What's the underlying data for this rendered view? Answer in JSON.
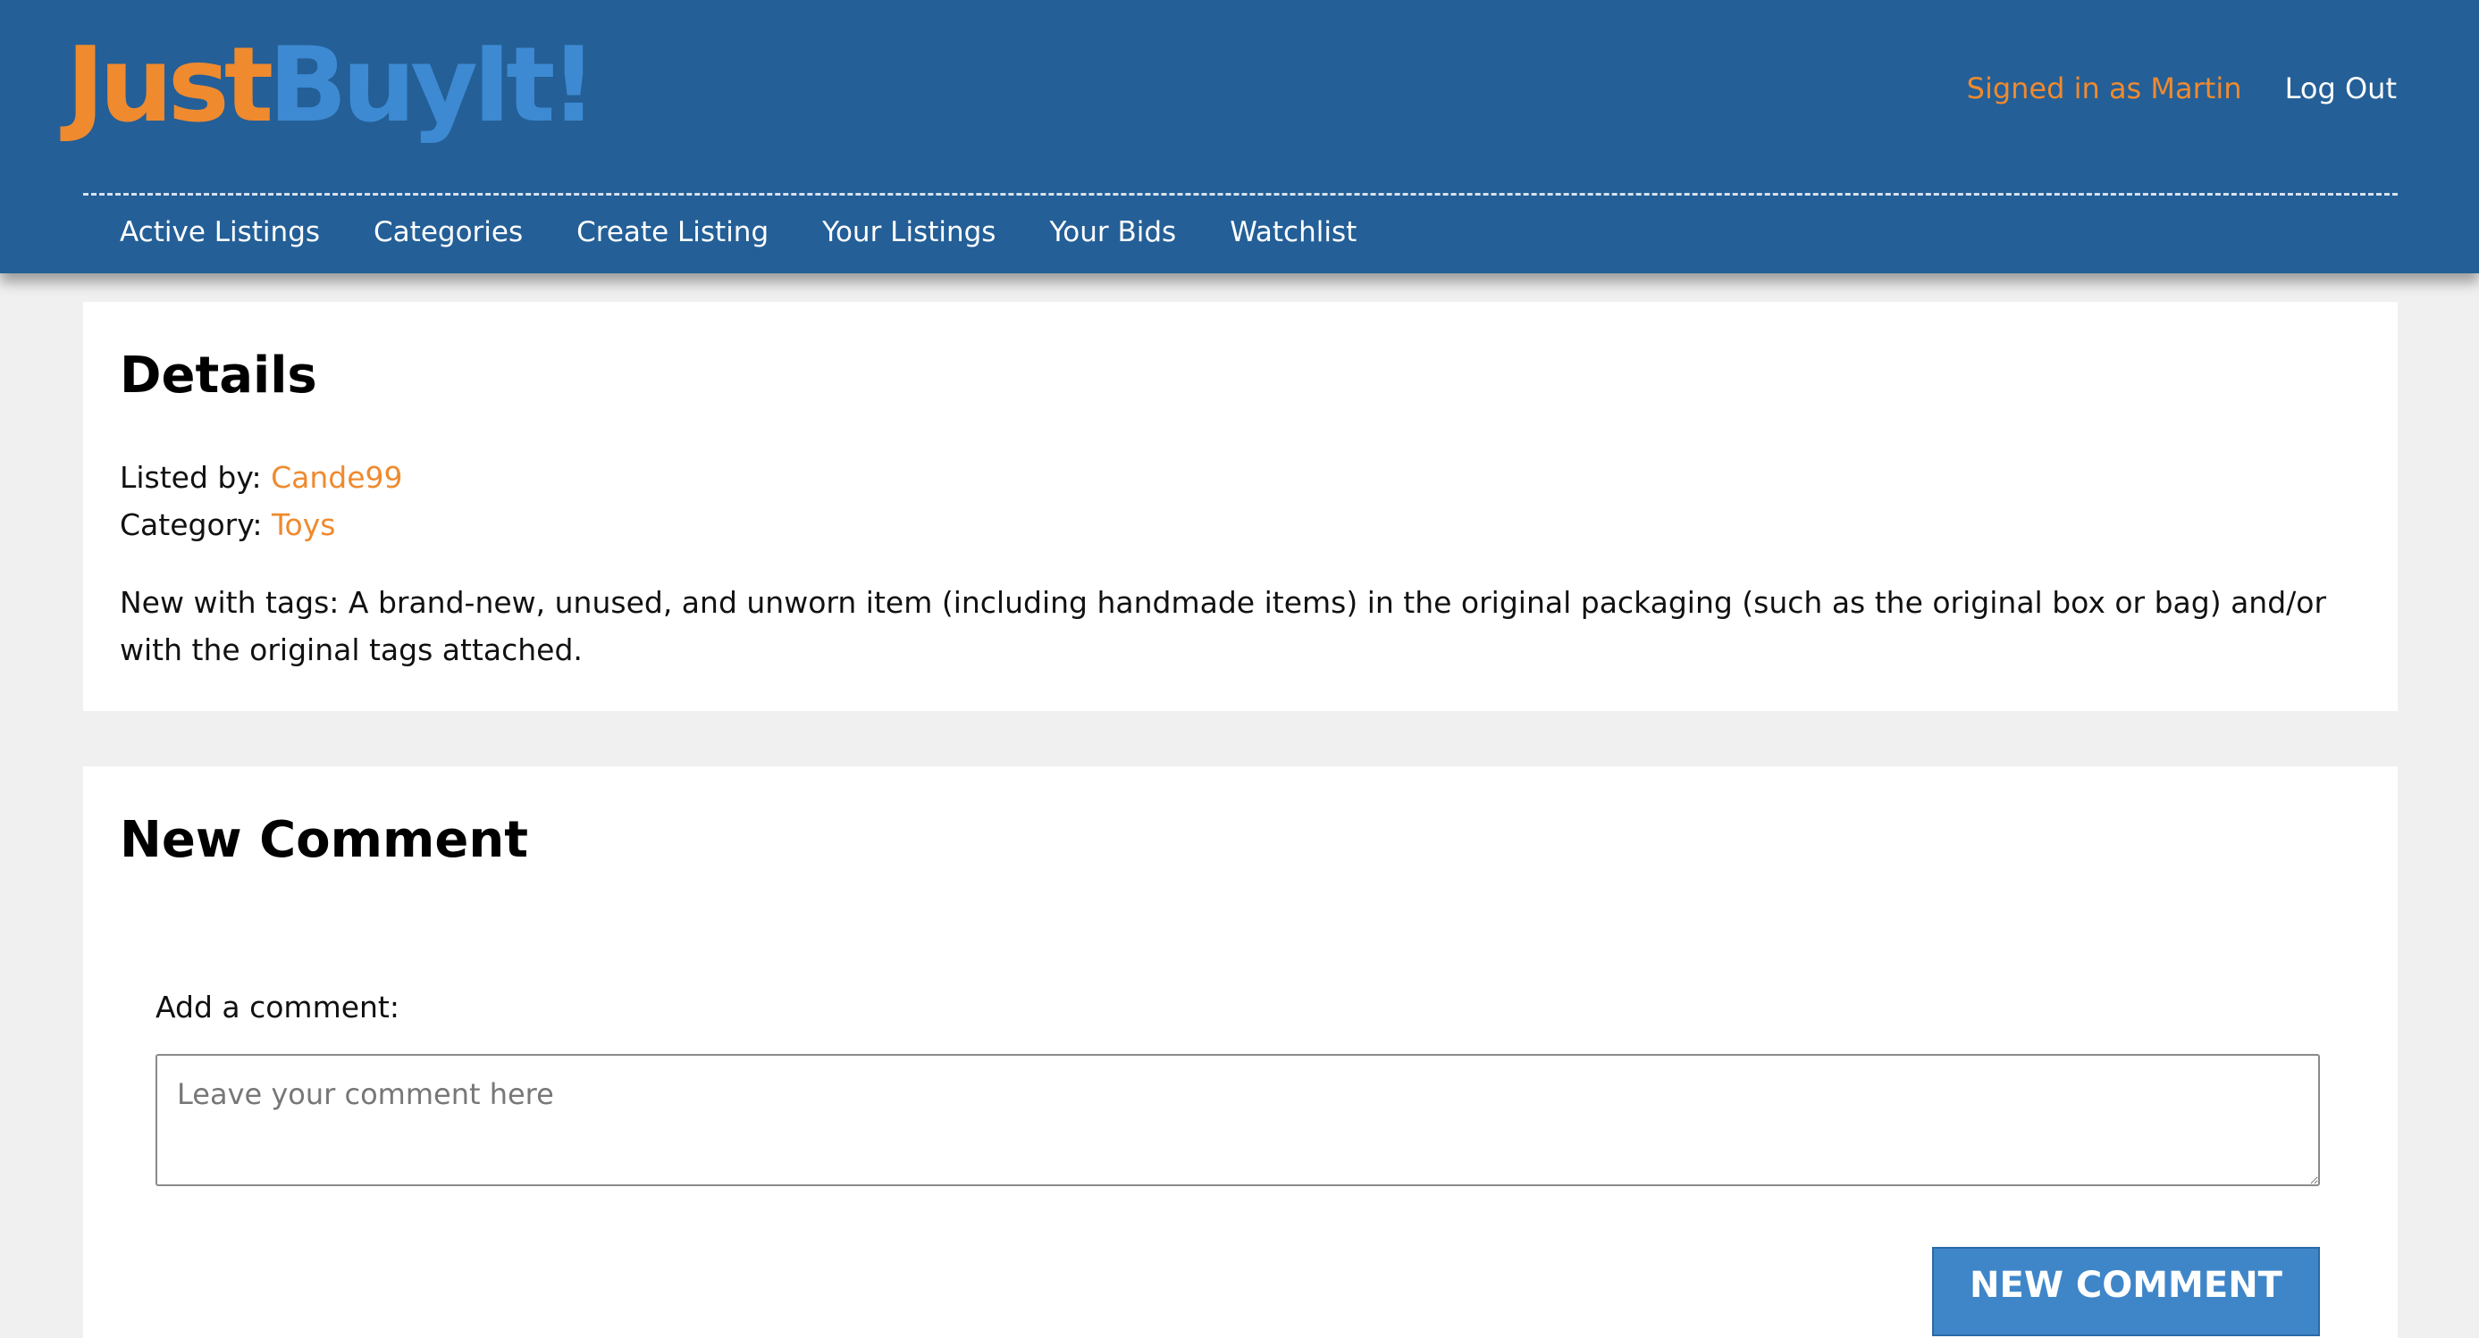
{
  "header": {
    "logo_part1": "Just",
    "logo_part2": "BuyIt!",
    "signed_in_text": "Signed in as Martin",
    "logout_label": "Log Out",
    "nav": [
      {
        "label": "Active Listings"
      },
      {
        "label": "Categories"
      },
      {
        "label": "Create Listing"
      },
      {
        "label": "Your Listings"
      },
      {
        "label": "Your Bids"
      },
      {
        "label": "Watchlist"
      }
    ]
  },
  "details": {
    "title": "Details",
    "listed_by_label": "Listed by:",
    "listed_by_value": "Cande99",
    "category_label": "Category:",
    "category_value": "Toys",
    "description": "New with tags: A brand-new, unused, and unworn item (including handmade items) in the original packaging (such as the original box or bag) and/or with the original tags attached."
  },
  "comment": {
    "title": "New Comment",
    "label": "Add a comment:",
    "placeholder": "Leave your comment here",
    "value": "",
    "submit_label": "New Comment"
  },
  "colors": {
    "header_bg": "#245f97",
    "accent_orange": "#ef8a2f",
    "accent_blue": "#3d8ad2",
    "button_bg": "#3f86c9",
    "page_bg": "#f0f0f0"
  }
}
